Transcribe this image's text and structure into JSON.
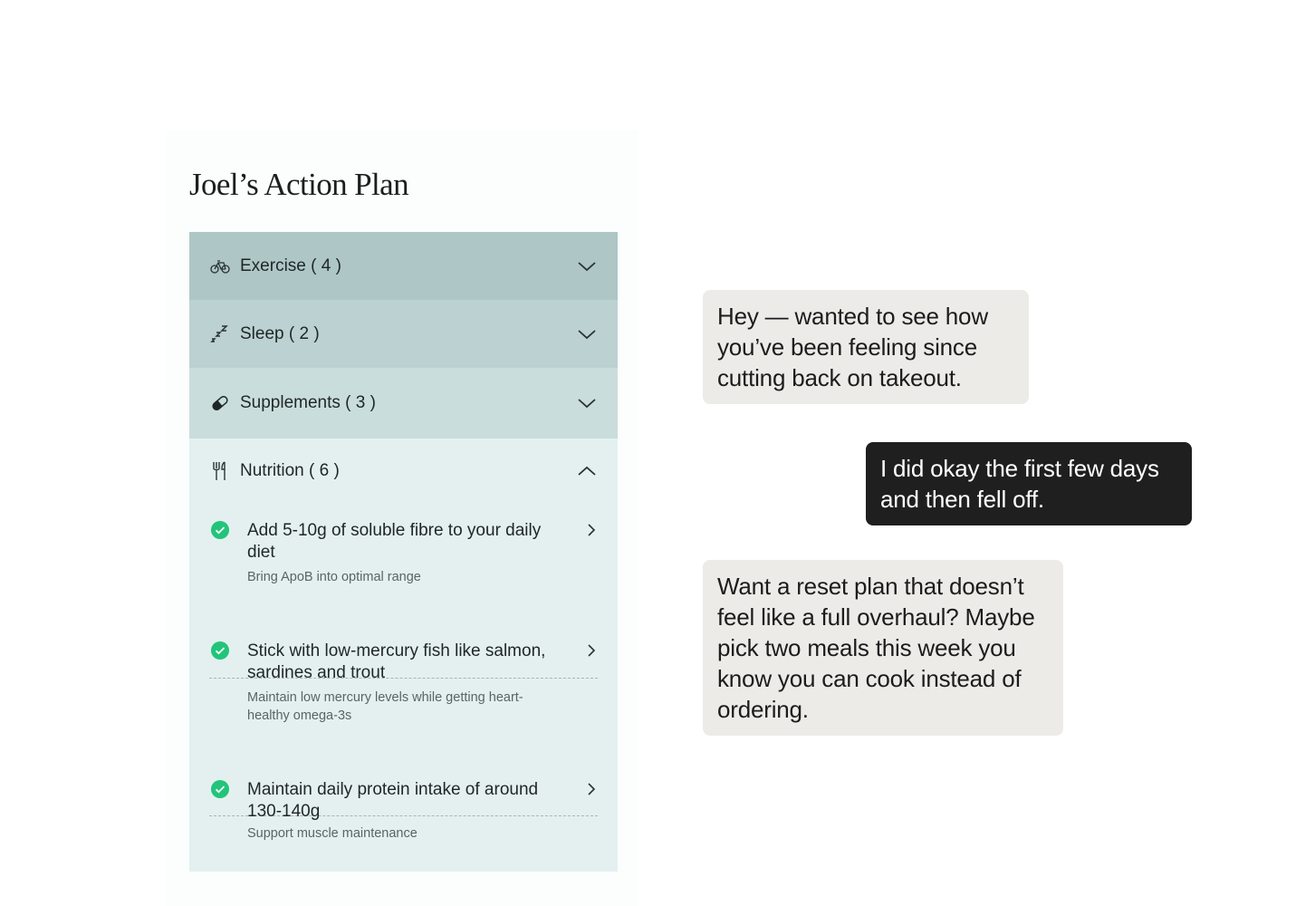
{
  "plan": {
    "title": "Joel’s Action Plan",
    "sections": [
      {
        "label": "Exercise ( 4 )",
        "icon": "bicycle-icon",
        "expanded": false
      },
      {
        "label": "Sleep ( 2 )",
        "icon": "sleep-zzz-icon",
        "expanded": false
      },
      {
        "label": "Supplements ( 3 )",
        "icon": "pill-icon",
        "expanded": false
      },
      {
        "label": "Nutrition ( 6 )",
        "icon": "fork-knife-icon",
        "expanded": true
      }
    ],
    "nutrition_items": [
      {
        "title": "Add 5-10g of soluble fibre to your daily diet",
        "subtitle": "Bring ApoB into optimal range",
        "status": "complete"
      },
      {
        "title": "Stick with low-mercury fish like salmon, sardines and trout",
        "subtitle": "Maintain low mercury levels while getting heart-healthy omega-3s",
        "status": "complete"
      },
      {
        "title": "Maintain daily protein intake of around 130-140g",
        "subtitle": "Support muscle maintenance",
        "status": "complete"
      }
    ]
  },
  "chat": {
    "messages": [
      {
        "from": "coach",
        "text": "Hey — wanted to see how you’ve been feeling since cutting back on takeout."
      },
      {
        "from": "user",
        "text": "I did okay the first few days and then fell off."
      },
      {
        "from": "coach",
        "text": "Want a reset plan that doesn’t feel like a full overhaul? Maybe pick two meals this week you know you can cook instead of ordering."
      }
    ]
  },
  "colors": {
    "exercise_bg": "#aec6c6",
    "sleep_bg": "#bcd1d1",
    "supplements_bg": "#c9dddc",
    "nutrition_bg": "#e4f0f0",
    "check_green": "#22c47a",
    "incoming_bubble": "#ecebe8",
    "outgoing_bubble": "#1f1f1f"
  }
}
